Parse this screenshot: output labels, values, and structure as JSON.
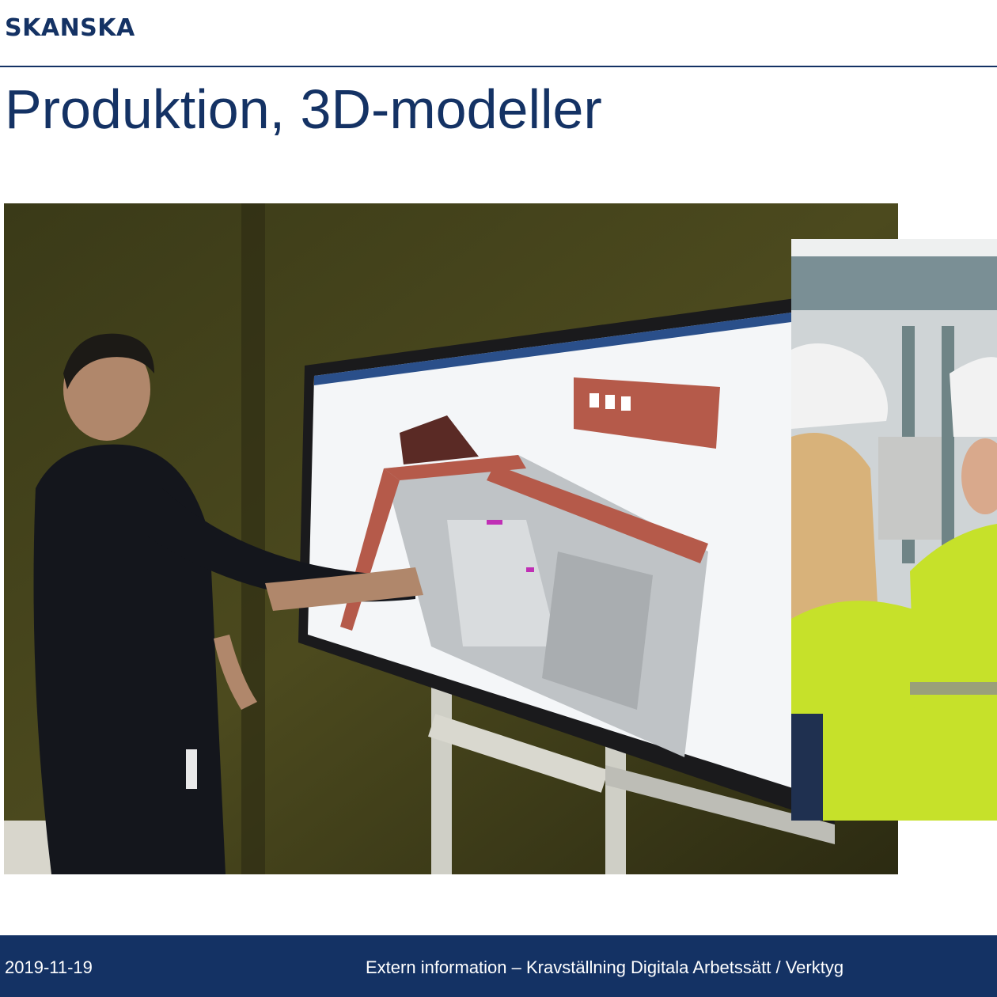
{
  "header": {
    "logo_text": "SKANSKA",
    "title": "Produktion, 3D-modeller"
  },
  "images": {
    "main_photo": "Man pointing at a 3D building model shown on a large touch-screen display",
    "side_photo": "Two construction workers in helmets and high-visibility jackets"
  },
  "footer": {
    "date": "2019-11-19",
    "info": "Extern information – Kravställning Digitala Arbetssätt / Verktyg"
  },
  "colors": {
    "brand_blue": "#143264",
    "background": "#ffffff",
    "footer_text": "#ffffff"
  }
}
